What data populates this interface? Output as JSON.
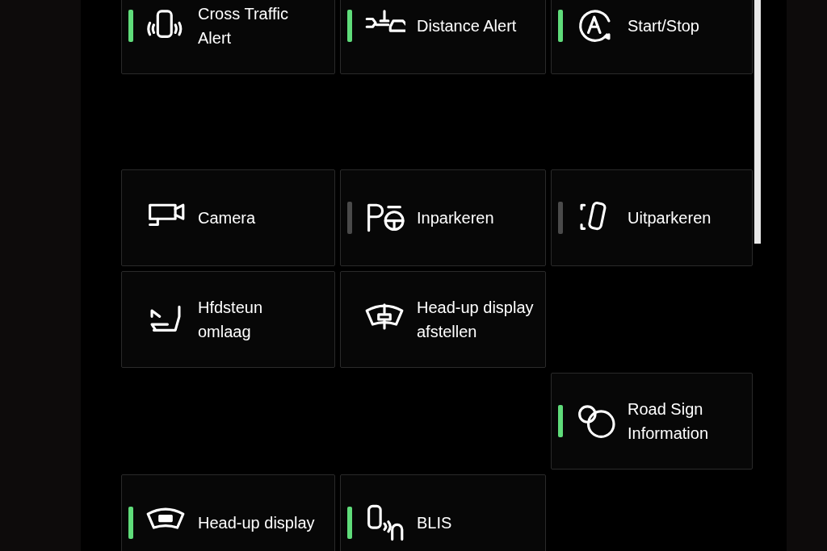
{
  "tiles": [
    {
      "kind": "cross-traffic",
      "on": true,
      "label": "Cross Traffic\nAlert"
    },
    {
      "kind": "distance",
      "on": true,
      "label": "Distance Alert"
    },
    {
      "kind": "start-stop",
      "on": true,
      "label": "Start/Stop"
    },
    {
      "kind": "camera",
      "label": "Camera"
    },
    {
      "kind": "park-in",
      "on": false,
      "label": "Inparkeren"
    },
    {
      "kind": "park-out",
      "on": false,
      "label": "Uitparkeren"
    },
    {
      "kind": "seat",
      "label": "Hfdsteun\nomlaag"
    },
    {
      "kind": "hud-adjust",
      "label": "Head-up display\nafstellen"
    },
    {
      "kind": "road-sign",
      "on": true,
      "label": "Road Sign\nInformation"
    },
    {
      "kind": "hud",
      "on": true,
      "label": "Head-up display"
    },
    {
      "kind": "blis",
      "on": true,
      "label": "BLIS"
    }
  ]
}
